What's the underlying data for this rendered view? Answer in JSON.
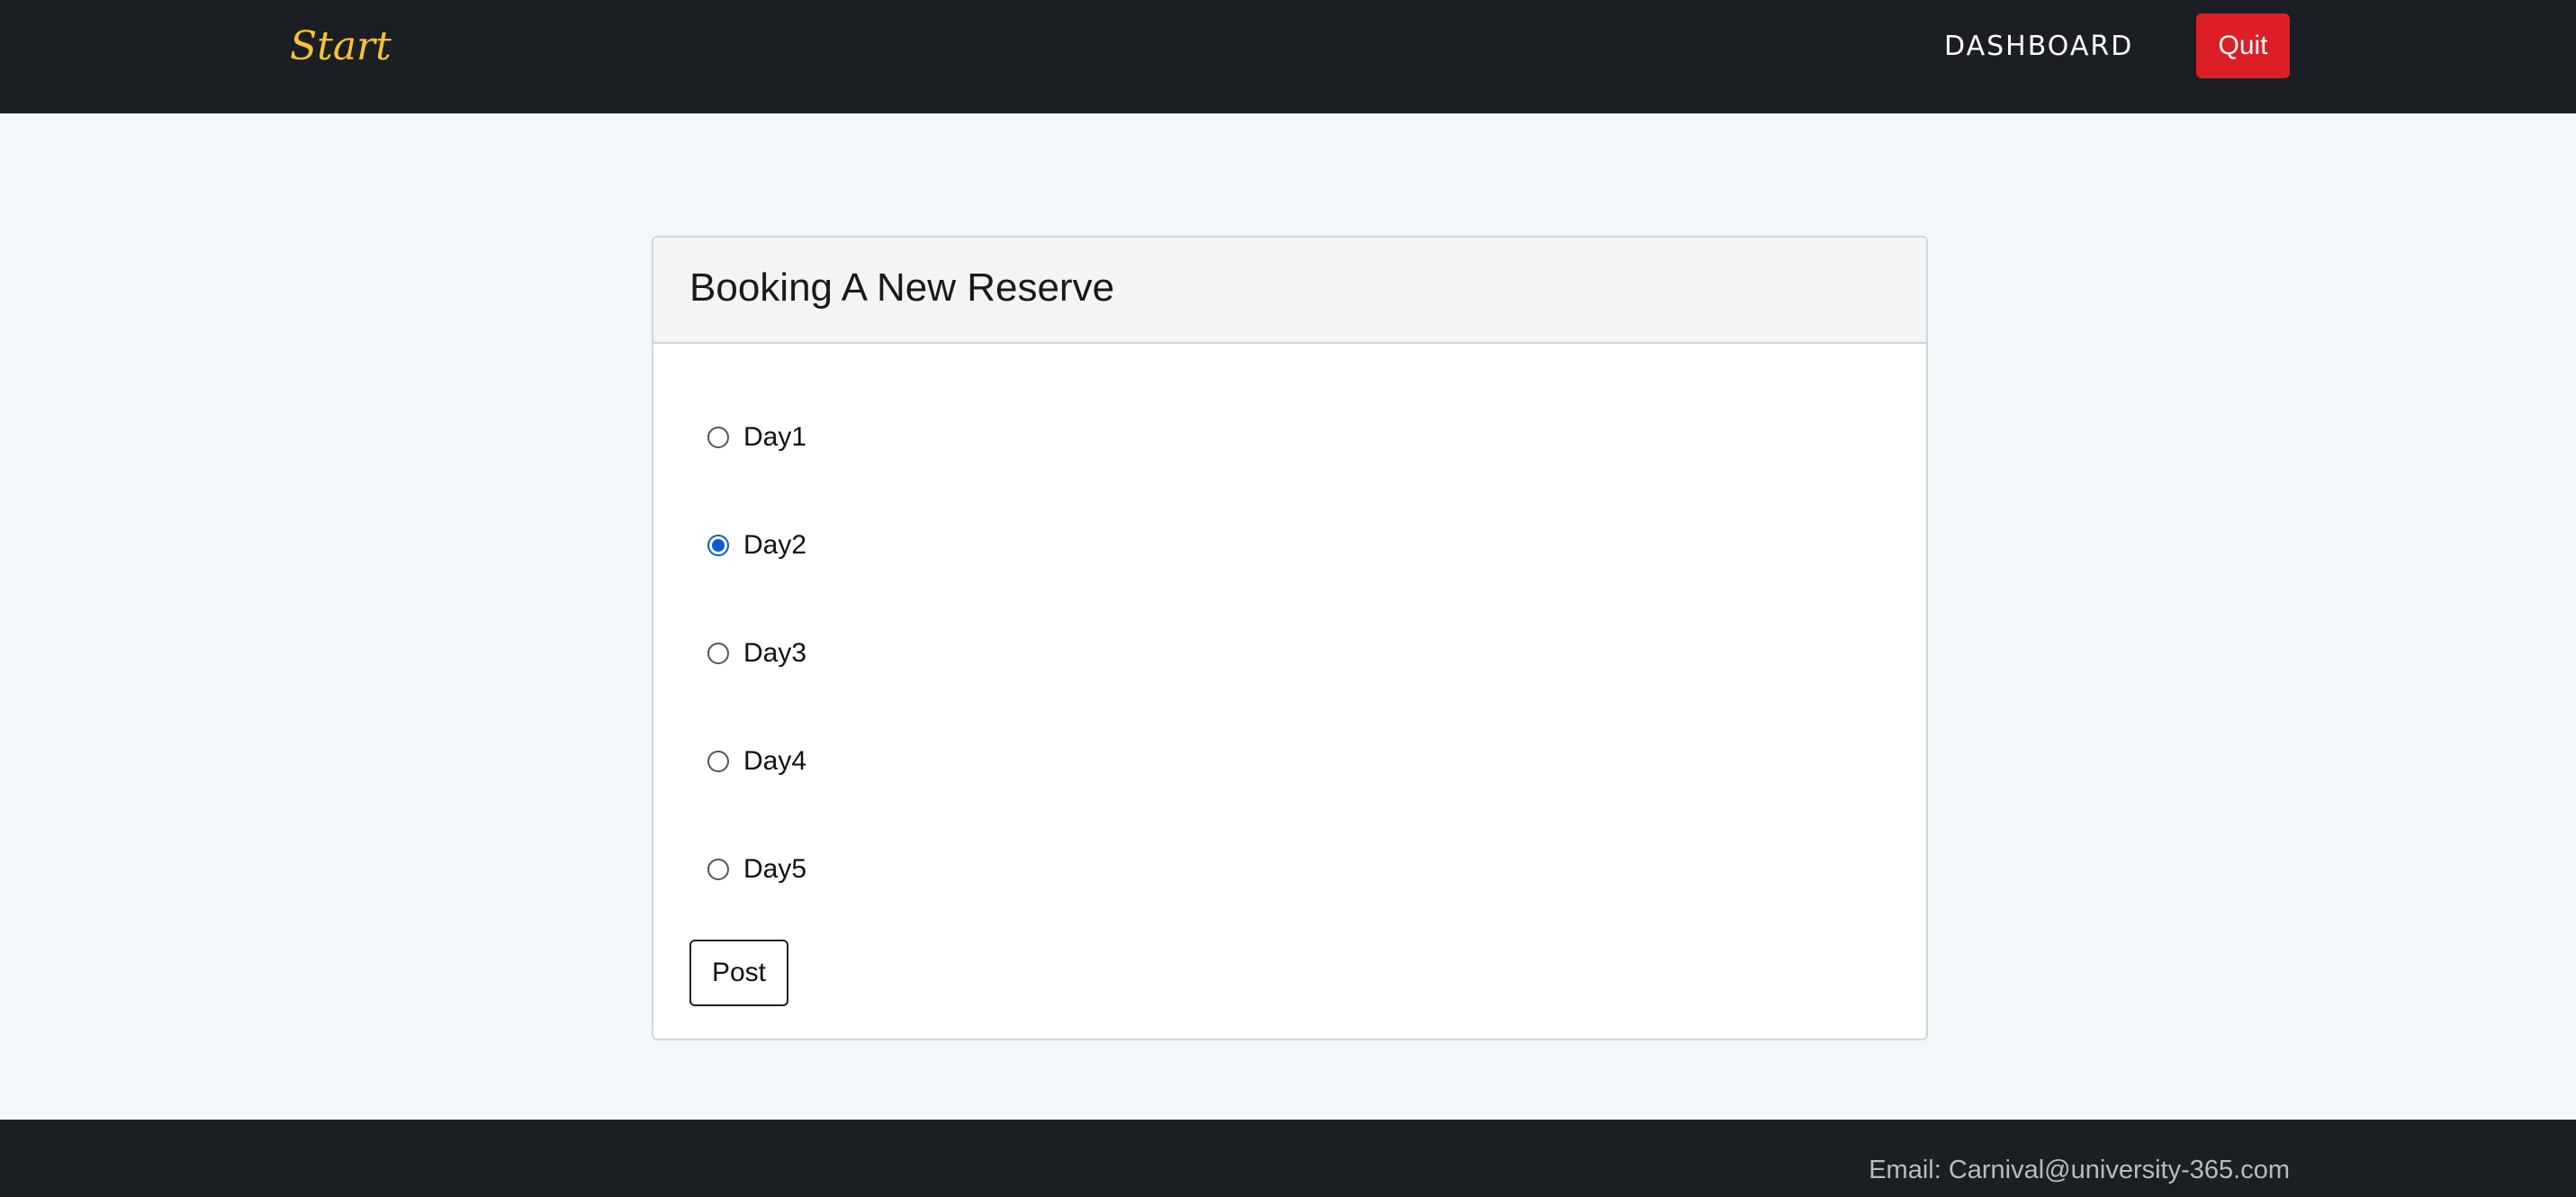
{
  "navbar": {
    "brand": "Start",
    "dashboard_link": "DASHBOARD",
    "quit_button": "Quit"
  },
  "booking": {
    "title": "Booking A New Reserve",
    "options": [
      {
        "label": "Day1",
        "checked": false
      },
      {
        "label": "Day2",
        "checked": true
      },
      {
        "label": "Day3",
        "checked": false
      },
      {
        "label": "Day4",
        "checked": false
      },
      {
        "label": "Day5",
        "checked": false
      }
    ],
    "submit_label": "Post"
  },
  "footer": {
    "email_text": "Email: Carnival@university-365.com"
  },
  "colors": {
    "navbar_bg": "#1b1e22",
    "brand": "#f5c431",
    "quit_bg": "#dc1f26",
    "radio_checked": "#0b5bd8",
    "page_bg": "#f4f7fa"
  }
}
